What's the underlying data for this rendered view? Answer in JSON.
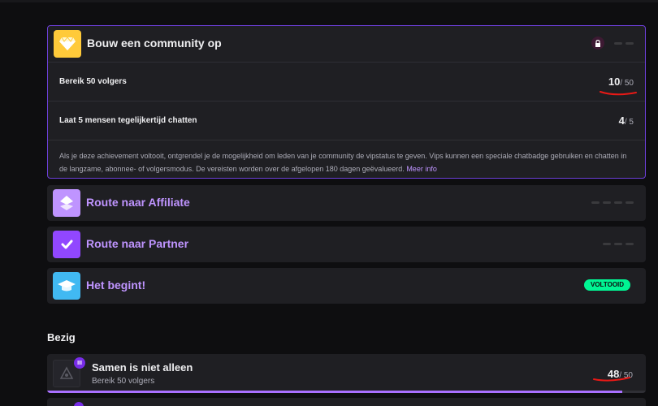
{
  "expanded_card": {
    "title": "Bouw een community op",
    "rows": [
      {
        "label": "Bereik 50 volgers",
        "current": "10",
        "total": "/ 50"
      },
      {
        "label": "Laat 5 mensen tegelijkertijd chatten",
        "current": "4",
        "total": "/ 5"
      }
    ],
    "description": "Als je deze achievement voltooit, ontgrendel je de mogelijkheid om leden van je community de vipstatus te geven. Vips kunnen een speciale chatbadge gebruiken en chatten in de langzame, abonnee- of volgersmodus. De vereisten worden over de afgelopen 180 dagen geëvalueerd.",
    "more_info": "Meer info"
  },
  "cards": [
    {
      "title": "Route naar Affiliate"
    },
    {
      "title": "Route naar Partner"
    },
    {
      "title": "Het begint!",
      "badge": "VOLTOOID"
    }
  ],
  "section": {
    "title": "Bezig"
  },
  "progress_card": {
    "title": "Samen is niet alleen",
    "subtitle": "Bereik 50 volgers",
    "current": "48",
    "total": "/ 50",
    "tier": "III",
    "progress": 0.96
  },
  "colors": {
    "accent": "#bf94ff",
    "border_active": "#6c3fd9",
    "success": "#00f593",
    "annotation": "#e91916"
  }
}
